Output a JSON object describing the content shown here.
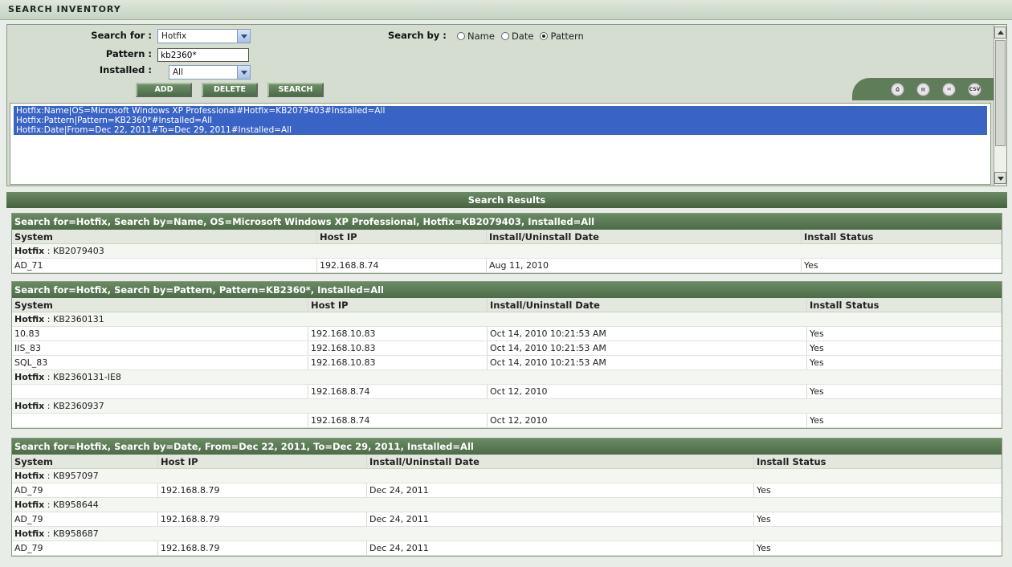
{
  "title": "SEARCH INVENTORY",
  "form": {
    "search_for_label": "Search for :",
    "search_for_value": "Hotfix",
    "pattern_label": "Pattern :",
    "pattern_value": "kb2360*",
    "installed_label": "Installed :",
    "installed_value": "All",
    "search_by_label": "Search by :",
    "radio_options": [
      {
        "label": "Name",
        "selected": false
      },
      {
        "label": "Date",
        "selected": false
      },
      {
        "label": "Pattern",
        "selected": true
      }
    ],
    "buttons": {
      "add": "ADD",
      "delete": "DELETE",
      "search": "SEARCH"
    }
  },
  "toolbar_icons": [
    "print-icon",
    "pdf-icon",
    "email-icon",
    "csv-icon"
  ],
  "toolbar_csv_text": "CSV",
  "queries": [
    "Hotfix:Name|OS=Microsoft Windows XP Professional#Hotfix=KB2079403#Installed=All",
    "Hotfix:Pattern|Pattern=KB2360*#Installed=All",
    "Hotfix:Date|From=Dec 22, 2011#To=Dec 29, 2011#Installed=All"
  ],
  "results_title": "Search Results",
  "hotfix_label": "Hotfix",
  "columns": [
    "System",
    "Host IP",
    "Install/Uninstall Date",
    "Install Status"
  ],
  "blocks": [
    {
      "header": "Search for=Hotfix, Search by=Name, OS=Microsoft Windows XP Professional, Hotfix=KB2079403, Installed=All",
      "groups": [
        {
          "hotfix": ": KB2079403",
          "rows": [
            [
              "AD_71",
              "192.168.8.74",
              "Aug 11, 2010",
              "Yes"
            ]
          ]
        }
      ]
    },
    {
      "header": "Search for=Hotfix, Search by=Pattern, Pattern=KB2360*, Installed=All",
      "groups": [
        {
          "hotfix": ": KB2360131",
          "rows": [
            [
              "10.83",
              "192.168.10.83",
              "Oct 14, 2010 10:21:53 AM",
              "Yes"
            ],
            [
              "IIS_83",
              "192.168.10.83",
              "Oct 14, 2010 10:21:53 AM",
              "Yes"
            ],
            [
              "SQL_83",
              "192.168.10.83",
              "Oct 14, 2010 10:21:53 AM",
              "Yes"
            ]
          ]
        },
        {
          "hotfix": ": KB2360131-IE8",
          "rows": [
            [
              "",
              "192.168.8.74",
              "Oct 12, 2010",
              "Yes"
            ]
          ]
        },
        {
          "hotfix": ": KB2360937",
          "rows": [
            [
              "",
              "192.168.8.74",
              "Oct 12, 2010",
              "Yes"
            ]
          ]
        }
      ]
    },
    {
      "header": "Search for=Hotfix, Search by=Date, From=Dec 22, 2011, To=Dec 29, 2011, Installed=All",
      "groups": [
        {
          "hotfix": ": KB957097",
          "rows": [
            [
              "AD_79",
              "192.168.8.79",
              "Dec 24, 2011",
              "Yes"
            ]
          ]
        },
        {
          "hotfix": ": KB958644",
          "rows": [
            [
              "AD_79",
              "192.168.8.79",
              "Dec 24, 2011",
              "Yes"
            ]
          ]
        },
        {
          "hotfix": ": KB958687",
          "rows": [
            [
              "AD_79",
              "192.168.8.79",
              "Dec 24, 2011",
              "Yes"
            ]
          ]
        }
      ]
    }
  ]
}
